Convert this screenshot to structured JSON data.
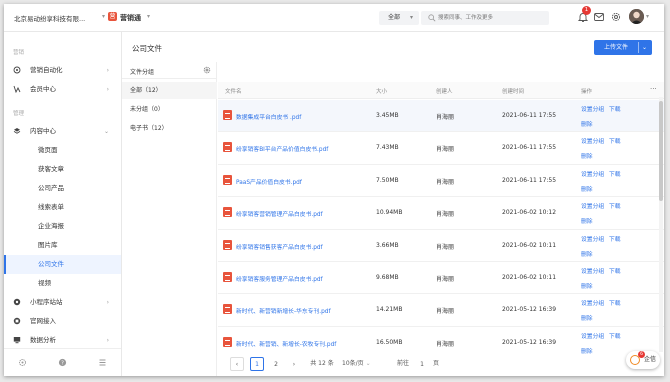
{
  "topbar": {
    "company": "北京易动纷享科技有限...",
    "brand_logo_char": "营",
    "brand": "营销通",
    "scope": "全部",
    "search_placeholder": "搜索同事、工作及更多",
    "notification_count": "1"
  },
  "sidebar": {
    "section1": "营销",
    "marketing_automation": "营销自动化",
    "member_center": "会员中心",
    "section2": "管理",
    "content_center": "内容中心",
    "sub_items": [
      "微页面",
      "获客文章",
      "公司产品",
      "线索表单",
      "企业海报",
      "图片库",
      "公司文件",
      "视频"
    ],
    "mini_program": "小程序站站",
    "official_account": "官网接入",
    "data_analysis": "数据分析"
  },
  "main": {
    "title": "公司文件",
    "upload_label": "上传文件"
  },
  "groups": {
    "header": "文件分组",
    "items": [
      "全部（12）",
      "未分组（0）",
      "电子书（12）"
    ]
  },
  "table": {
    "columns": [
      "文件名",
      "大小",
      "创建人",
      "创建时间",
      "操作"
    ],
    "more": "···",
    "op_set_group": "设置分组",
    "op_download": "下载",
    "op_delete": "删除",
    "rows": [
      {
        "name": "数据集成平台白皮书 .pdf",
        "size": "3.45MB",
        "creator": "肖海丽",
        "time": "2021-06-11 17:55"
      },
      {
        "name": "纷享销客BI平台产品价值白皮书.pdf",
        "size": "7.43MB",
        "creator": "肖海丽",
        "time": "2021-06-11 17:55"
      },
      {
        "name": "PaaS产品价值白皮书.pdf",
        "size": "7.50MB",
        "creator": "肖海丽",
        "time": "2021-06-11 17:55"
      },
      {
        "name": "纷享销客营销管理产品白皮书.pdf",
        "size": "10.94MB",
        "creator": "肖海丽",
        "time": "2021-06-02 10:12"
      },
      {
        "name": "纷享销客销售获客产品白皮书.pdf",
        "size": "3.66MB",
        "creator": "肖海丽",
        "time": "2021-06-02 10:11"
      },
      {
        "name": "纷享销客服务管理产品白皮书.pdf",
        "size": "9.68MB",
        "creator": "肖海丽",
        "time": "2021-06-02 10:11"
      },
      {
        "name": "新时代、新营销新增长-华东专刊.pdf",
        "size": "14.21MB",
        "creator": "肖海丽",
        "time": "2021-05-12 16:39"
      },
      {
        "name": "新时代、新营销、新增长-农牧专刊.pdf",
        "size": "16.50MB",
        "creator": "肖海丽",
        "time": "2021-05-12 16:39"
      }
    ]
  },
  "pager": {
    "page1": "1",
    "page2": "2",
    "total": "共 12 条",
    "page_size": "10条/页",
    "goto_label": "前往",
    "goto_value": "1",
    "page_suffix": "页"
  },
  "chat": {
    "badge": "6",
    "label": "企信"
  },
  "colors": {
    "primary": "#2f74e8",
    "file_icon": "#e8543c",
    "badge": "#e53935"
  }
}
